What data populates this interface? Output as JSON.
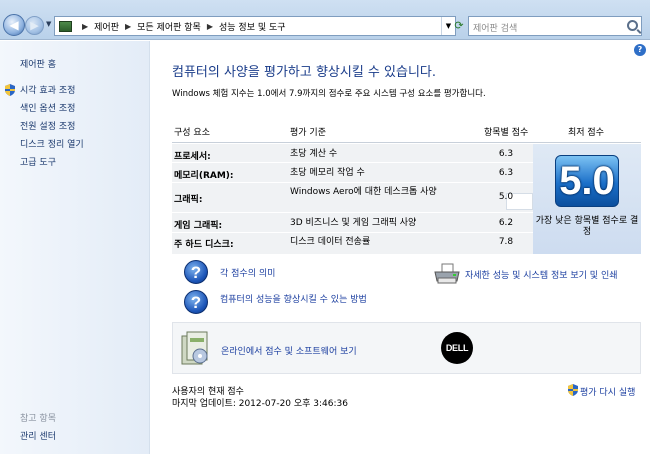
{
  "address_bar": {
    "breadcrumbs": [
      "제어판",
      "모든 제어판 항목",
      "성능 정보 및 도구"
    ],
    "search_placeholder": "제어판 검색"
  },
  "sidebar": {
    "home": "제어판 홈",
    "tasks": [
      "시각 효과 조정",
      "색인 옵션 조정",
      "전원 설정 조정",
      "디스크 정리 열기",
      "고급 도구"
    ],
    "see_also_title": "참고 항목",
    "see_also": [
      "관리 센터"
    ]
  },
  "main": {
    "title": "컴퓨터의 사양을 평가하고 향상시킬 수 있습니다.",
    "description": "Windows 체험 지수는 1.0에서 7.9까지의 점수로 주요 시스템 구성 요소를 평가합니다.",
    "table": {
      "headers": {
        "component": "구성 요소",
        "rated": "평가 기준",
        "subscore": "항목별 점수",
        "base": "최저 점수"
      },
      "rows": [
        {
          "name": "프로세서:",
          "desc": "초당 계산 수",
          "score": "6.3"
        },
        {
          "name": "메모리(RAM):",
          "desc": "초당 메모리 작업 수",
          "score": "6.3"
        },
        {
          "name": "그래픽:",
          "desc": "Windows Aero에 대한 데스크톱 사양",
          "score": "5.0"
        },
        {
          "name": "게임 그래픽:",
          "desc": "3D 비즈니스 및 게임 그래픽 사양",
          "score": "6.2"
        },
        {
          "name": "주 하드 디스크:",
          "desc": "디스크 데이터 전송률",
          "score": "7.8"
        }
      ],
      "base_score": "5.0",
      "base_label": "가장 낮은 항목별 점수로 결정"
    },
    "links": {
      "score_meaning": "각 점수의 의미",
      "improve": "컴퓨터의 성능을 향상시킬 수 있는 방법",
      "details": "자세한 성능 및 시스템 정보 보기 및 인쇄",
      "online": "온라인에서 점수 및 소프트웨어 보기",
      "rerun": "평가 다시 실행"
    },
    "dell_logo": "DELL",
    "footer": {
      "current": "사용자의 현재 점수",
      "last_update": "마지막 업데이트: 2012-07-20 오후 3:46:36"
    }
  },
  "colors": {
    "link": "#1c3fa0",
    "title": "#1a3c8a",
    "sidebar_link": "#1c3a6e"
  }
}
